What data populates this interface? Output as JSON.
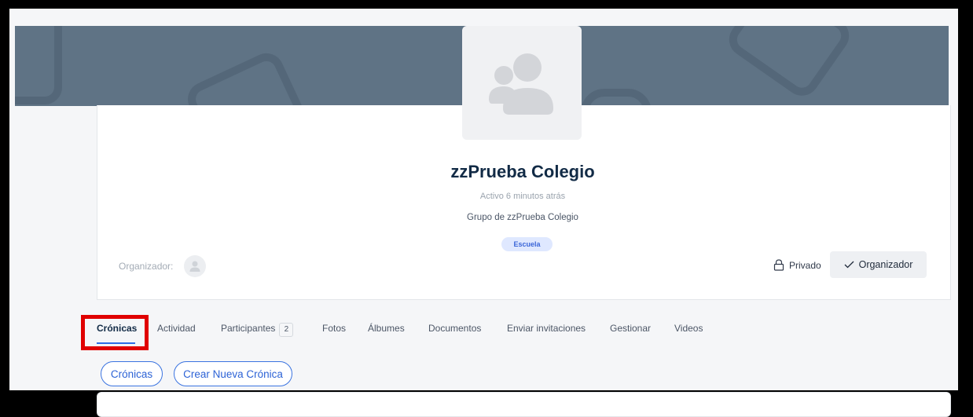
{
  "group": {
    "name": "zzPrueba Colegio",
    "activity": "Activo 6 minutos atrás",
    "description": "Grupo de zzPrueba Colegio",
    "type_tag": "Escuela",
    "organizer_label": "Organizador:",
    "privacy": "Privado",
    "role_button": "Organizador"
  },
  "tabs": [
    {
      "label": "Crónicas",
      "active": true
    },
    {
      "label": "Actividad"
    },
    {
      "label": "Participantes",
      "count": "2"
    },
    {
      "label": "Fotos"
    },
    {
      "label": "Álbumes"
    },
    {
      "label": "Documentos"
    },
    {
      "label": "Enviar invitaciones"
    },
    {
      "label": "Gestionar"
    },
    {
      "label": "Videos"
    }
  ],
  "subnav": {
    "cronicas": "Crónicas",
    "create": "Crear Nueva Crónica"
  },
  "colors": {
    "cover": "#5f7385",
    "accent": "#2e6de6",
    "highlight": "#e00000"
  },
  "icons": {
    "group_avatar": "group-icon",
    "organizer_avatar": "user-icon",
    "privacy": "lock-icon",
    "role": "check-icon"
  }
}
